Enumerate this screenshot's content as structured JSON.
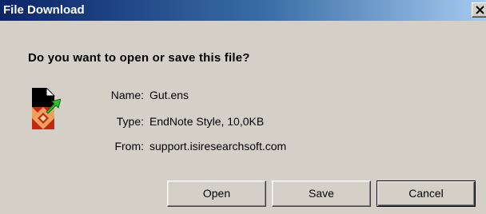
{
  "window": {
    "title": "File Download",
    "close_icon": "close-icon"
  },
  "prompt": {
    "question": "Do you want to open or save this file?"
  },
  "file": {
    "icon": "endnote-style-file-icon",
    "fields": [
      {
        "label": "Name:",
        "value": "Gut.ens"
      },
      {
        "label": "Type:",
        "value": "EndNote Style, 10,0KB"
      },
      {
        "label": "From:",
        "value": "support.isiresearchsoft.com"
      }
    ]
  },
  "buttons": {
    "open_label": "Open",
    "save_label": "Save",
    "cancel_label": "Cancel"
  },
  "colors": {
    "title_bar_start": "#0a246a",
    "title_bar_end": "#a6caf0",
    "dialog_background": "#d4d0c8"
  }
}
